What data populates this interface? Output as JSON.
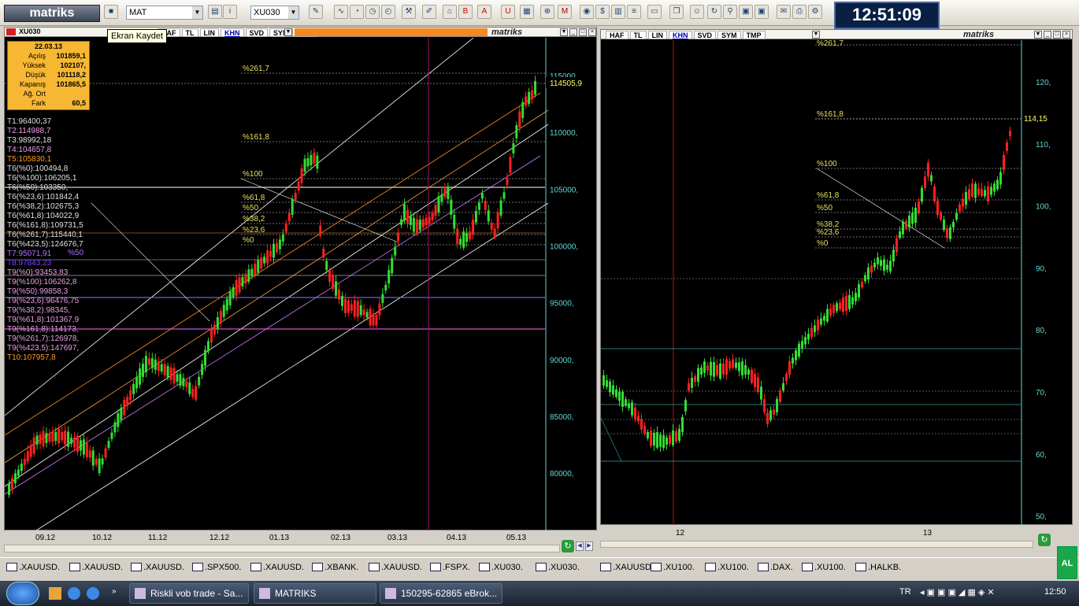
{
  "toolbar": {
    "logo": "matriks",
    "combo1": "MAT",
    "combo2": "XU030",
    "clock": "12:51:09",
    "tooltip": "Ekran Kaydet"
  },
  "left_panel": {
    "title_symbol": "XU030",
    "tabs": [
      "HAF",
      "TL",
      "LIN",
      "KHN",
      "SVD",
      "SYM",
      "TMP"
    ],
    "active_tab": "KHN",
    "brand": "matriks",
    "x_labels": [
      "09.12",
      "10.12",
      "11.12",
      "12.12",
      "01.13",
      "02.13",
      "03.13",
      "04.13",
      "05.13"
    ],
    "y_labels": [
      "115000,",
      "110000,",
      "105000,",
      "100000,",
      "95000,",
      "90000,",
      "85000,",
      "80000,"
    ],
    "price_tag": "114505,9",
    "fib_labels": [
      "%261,7",
      "%161,8",
      "%100",
      "%61,8",
      "%50",
      "%38,2",
      "%23,6",
      "%0"
    ],
    "info": {
      "date": "22.03.13",
      "rows": [
        {
          "k": "Açılış",
          "v": "101859,1"
        },
        {
          "k": "Yüksek",
          "v": "102107,"
        },
        {
          "k": "Düşük",
          "v": "101118,2"
        },
        {
          "k": "Kapanış",
          "v": "101865,5"
        },
        {
          "k": "Ağ. Ort",
          "v": ""
        },
        {
          "k": "Fark",
          "v": "60,5"
        }
      ]
    },
    "levels": [
      {
        "t": "T1:96400,37",
        "c": "#e0e0e0"
      },
      {
        "t": "T2:114988,7",
        "c": "#e9a0e0"
      },
      {
        "t": "T3:98992,18",
        "c": "#e0e0e0"
      },
      {
        "t": "T4:104657,8",
        "c": "#e9a0e0"
      },
      {
        "t": "T5:105830,1",
        "c": "#ff9a20"
      },
      {
        "t": "T6(%0):100494,8",
        "c": "#e0e0e0"
      },
      {
        "t": "T6(%100):106205,1",
        "c": "#e0e0e0"
      },
      {
        "t": "T6(%50):103350,",
        "c": "#e0e0e0"
      },
      {
        "t": "T6(%23,6):101842,4",
        "c": "#e0e0e0"
      },
      {
        "t": "T6(%38,2):102675,3",
        "c": "#e0e0e0"
      },
      {
        "t": "T6(%61,8):104022,9",
        "c": "#e0e0e0"
      },
      {
        "t": "T6(%161,8):109731,5",
        "c": "#e0e0e0"
      },
      {
        "t": "T6(%261,7):115440,1",
        "c": "#e0e0e0"
      },
      {
        "t": "T6(%423,5):124676,7",
        "c": "#e0e0e0"
      },
      {
        "t": "T7:95071,91",
        "c": "#b070ff"
      },
      {
        "t": "T8:97843,23",
        "c": "#7a40ff"
      },
      {
        "t": "T9(%0):93453,83",
        "c": "#e9a0e0"
      },
      {
        "t": "T9(%100):106262,8",
        "c": "#e9a0e0"
      },
      {
        "t": "T9(%50):99858,3",
        "c": "#e9a0e0"
      },
      {
        "t": "T9(%23,6):96476,75",
        "c": "#e9a0e0"
      },
      {
        "t": "T9(%38,2):98345,",
        "c": "#e9a0e0"
      },
      {
        "t": "T9(%61,8):101367,9",
        "c": "#e9a0e0"
      },
      {
        "t": "T9(%161,8):114173,",
        "c": "#e9a0e0"
      },
      {
        "t": "T9(%261,7):126978,",
        "c": "#e9a0e0"
      },
      {
        "t": "T9(%423,5):147697,",
        "c": "#e9a0e0"
      },
      {
        "t": "T10:107957,8",
        "c": "#ff9a20"
      }
    ],
    "overlay_50": "%50"
  },
  "right_panel": {
    "tabs": [
      "HAF",
      "TL",
      "LIN",
      "KHN",
      "SVD",
      "SYM",
      "TMP"
    ],
    "active_tab": "KHN",
    "brand": "matriks",
    "x_labels": [
      "12",
      "13"
    ],
    "y_labels": [
      "120,",
      "110,",
      "100,",
      "90,",
      "80,",
      "70,",
      "60,",
      "50,"
    ],
    "price_tag": "114,15",
    "fib_labels": [
      "%261,7",
      "%161,8",
      "%100",
      "%61,8",
      "%50",
      "%38,2",
      "%23,6",
      "%0"
    ]
  },
  "symbol_tabs": [
    ".XAUUSD.",
    ".XAUUSD.",
    ".XAUUSD.",
    ".SPX500.",
    ".XAUUSD.",
    ".XBANK.",
    ".XAUUSD.",
    ".FSPX.",
    ".XU030.",
    ".XU030.",
    ".XAUUSD.",
    ".XU100.",
    ".XU100.",
    ".DAX.",
    ".XU100.",
    ".HALKB."
  ],
  "alarm_badge": "AL",
  "taskbar": {
    "tasks": [
      "Riskli vob trade - Sa...",
      "MATRIKS",
      "150295-62865 eBrok..."
    ],
    "lang": "TR",
    "time": "12:50"
  },
  "colors": {
    "up": "#33dd33",
    "down": "#ff2020",
    "axis": "#5fd7d7",
    "fib": "#e8e05a",
    "bg": "#000000"
  }
}
